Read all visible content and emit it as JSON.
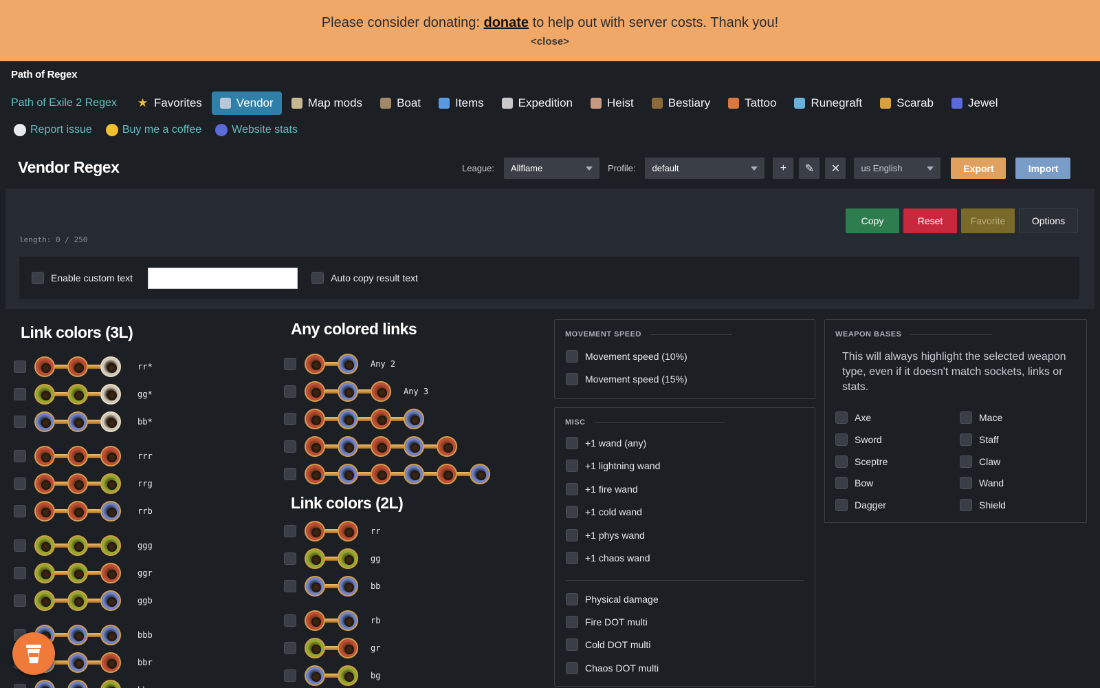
{
  "banner": {
    "prefix": "Please consider donating: ",
    "link": "donate",
    "suffix": " to help out with server costs. Thank you!",
    "close": "<close>"
  },
  "app_title": "Path of Regex",
  "nav": {
    "poe2": "Path of Exile 2 Regex",
    "items": [
      {
        "label": "Favorites",
        "icon": "star-icon"
      },
      {
        "label": "Vendor",
        "icon": "vendor-icon",
        "active": true
      },
      {
        "label": "Map mods",
        "icon": "map-icon"
      },
      {
        "label": "Boat",
        "icon": "boat-icon"
      },
      {
        "label": "Items",
        "icon": "items-icon"
      },
      {
        "label": "Expedition",
        "icon": "expedition-icon"
      },
      {
        "label": "Heist",
        "icon": "heist-icon"
      },
      {
        "label": "Bestiary",
        "icon": "bestiary-icon"
      },
      {
        "label": "Tattoo",
        "icon": "tattoo-icon"
      },
      {
        "label": "Runegraft",
        "icon": "runegraft-icon"
      },
      {
        "label": "Scarab",
        "icon": "scarab-icon"
      },
      {
        "label": "Jewel",
        "icon": "jewel-icon"
      }
    ]
  },
  "links": [
    {
      "label": "Report issue",
      "icon": "github-icon"
    },
    {
      "label": "Buy me a coffee",
      "icon": "coffee-icon"
    },
    {
      "label": "Website stats",
      "icon": "stats-icon"
    }
  ],
  "page_title": "Vendor Regex",
  "controls": {
    "league_label": "League:",
    "league_value": "Allflame",
    "profile_label": "Profile:",
    "profile_value": "default",
    "language_value": "us English",
    "add": "+",
    "edit": "✎",
    "delete": "✕",
    "export": "Export",
    "import": "Import"
  },
  "workspace": {
    "copy": "Copy",
    "reset": "Reset",
    "favorite": "Favorite",
    "options": "Options",
    "length": "length: 0 / 250",
    "enable_custom": "Enable custom text",
    "auto_copy": "Auto copy result text",
    "custom_value": ""
  },
  "link3": {
    "title": "Link colors (3L)",
    "rows": [
      {
        "code": "rr*",
        "sockets": "rrw"
      },
      {
        "code": "gg*",
        "sockets": "ggw"
      },
      {
        "code": "bb*",
        "sockets": "bbw"
      },
      {
        "code": "rrr",
        "sockets": "rrr"
      },
      {
        "code": "rrg",
        "sockets": "rrg"
      },
      {
        "code": "rrb",
        "sockets": "rrb"
      },
      {
        "code": "ggg",
        "sockets": "ggg"
      },
      {
        "code": "ggr",
        "sockets": "ggr"
      },
      {
        "code": "ggb",
        "sockets": "ggb"
      },
      {
        "code": "bbb",
        "sockets": "bbb"
      },
      {
        "code": "bbr",
        "sockets": "bbr"
      },
      {
        "code": "bbg",
        "sockets": "bbg"
      }
    ]
  },
  "anylinks": {
    "title": "Any colored links",
    "rows": [
      {
        "code": "Any 2",
        "count": 2
      },
      {
        "code": "Any 3",
        "count": 3
      },
      {
        "code": "",
        "count": 4
      },
      {
        "code": "",
        "count": 5
      },
      {
        "code": "",
        "count": 6
      }
    ]
  },
  "link2": {
    "title": "Link colors (2L)",
    "rows": [
      {
        "code": "rr",
        "sockets": "rr"
      },
      {
        "code": "gg",
        "sockets": "gg"
      },
      {
        "code": "bb",
        "sockets": "bb"
      },
      {
        "code": "rb",
        "sockets": "rb"
      },
      {
        "code": "gr",
        "sockets": "gr"
      },
      {
        "code": "bg",
        "sockets": "bg"
      }
    ]
  },
  "movement": {
    "title": "MOVEMENT SPEED",
    "options": [
      "Movement speed (10%)",
      "Movement speed (15%)"
    ]
  },
  "misc": {
    "title": "MISC",
    "options": [
      "+1 wand (any)",
      "+1 lightning wand",
      "+1 fire wand",
      "+1 cold wand",
      "+1 phys wand",
      "+1 chaos wand"
    ],
    "options2": [
      "Physical damage",
      "Fire DOT multi",
      "Cold DOT multi",
      "Chaos DOT multi"
    ]
  },
  "weapons": {
    "title": "WEAPON BASES",
    "hint": "This will always highlight the selected weapon type, even if it doesn't match sockets, links or stats.",
    "left": [
      "Axe",
      "Sword",
      "Sceptre",
      "Bow",
      "Dagger"
    ],
    "right": [
      "Mace",
      "Staff",
      "Claw",
      "Wand",
      "Shield"
    ]
  },
  "colors": {
    "banner": "#f0a868",
    "accent": "#2f7fa8",
    "copy": "#2e7d4f",
    "reset": "#c8283c",
    "favorite": "#7a6a2a",
    "export": "#e0a060",
    "import": "#7a9cc8"
  }
}
